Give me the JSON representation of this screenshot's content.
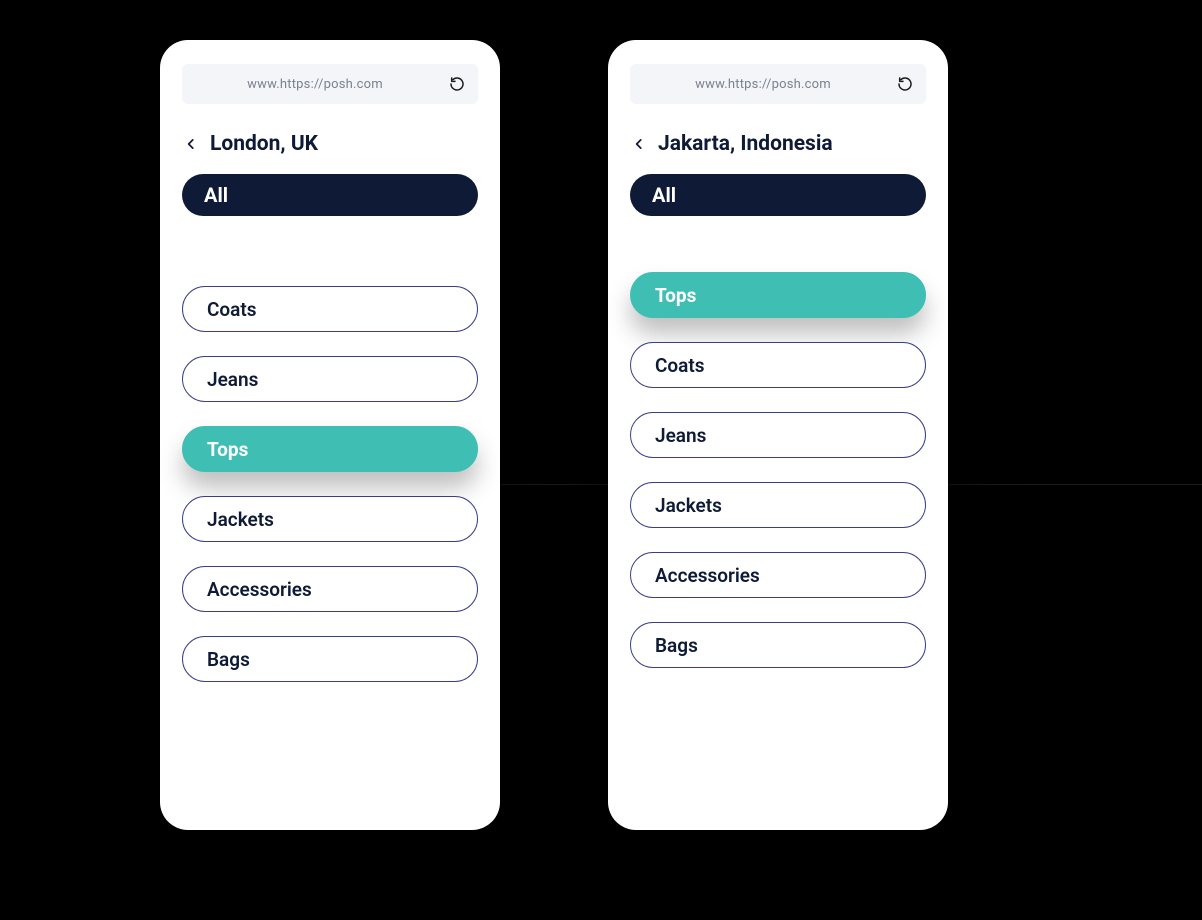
{
  "colors": {
    "accent_teal": "#3fbfb3",
    "primary_navy": "#0e1a36",
    "pill_border": "#3c3c8a",
    "urlbar_bg": "#f3f5f8"
  },
  "url": "www.https://posh.com",
  "pill_all_label": "All",
  "phones": {
    "left": {
      "title": "London, UK",
      "categories": [
        {
          "label": "Coats",
          "highlight": false
        },
        {
          "label": "Jeans",
          "highlight": false
        },
        {
          "label": "Tops",
          "highlight": true
        },
        {
          "label": "Jackets",
          "highlight": false
        },
        {
          "label": "Accessories",
          "highlight": false
        },
        {
          "label": "Bags",
          "highlight": false
        }
      ]
    },
    "right": {
      "title": "Jakarta, Indonesia",
      "categories": [
        {
          "label": "Tops",
          "highlight": true
        },
        {
          "label": "Coats",
          "highlight": false
        },
        {
          "label": "Jeans",
          "highlight": false
        },
        {
          "label": "Jackets",
          "highlight": false
        },
        {
          "label": "Accessories",
          "highlight": false
        },
        {
          "label": "Bags",
          "highlight": false
        }
      ]
    }
  }
}
